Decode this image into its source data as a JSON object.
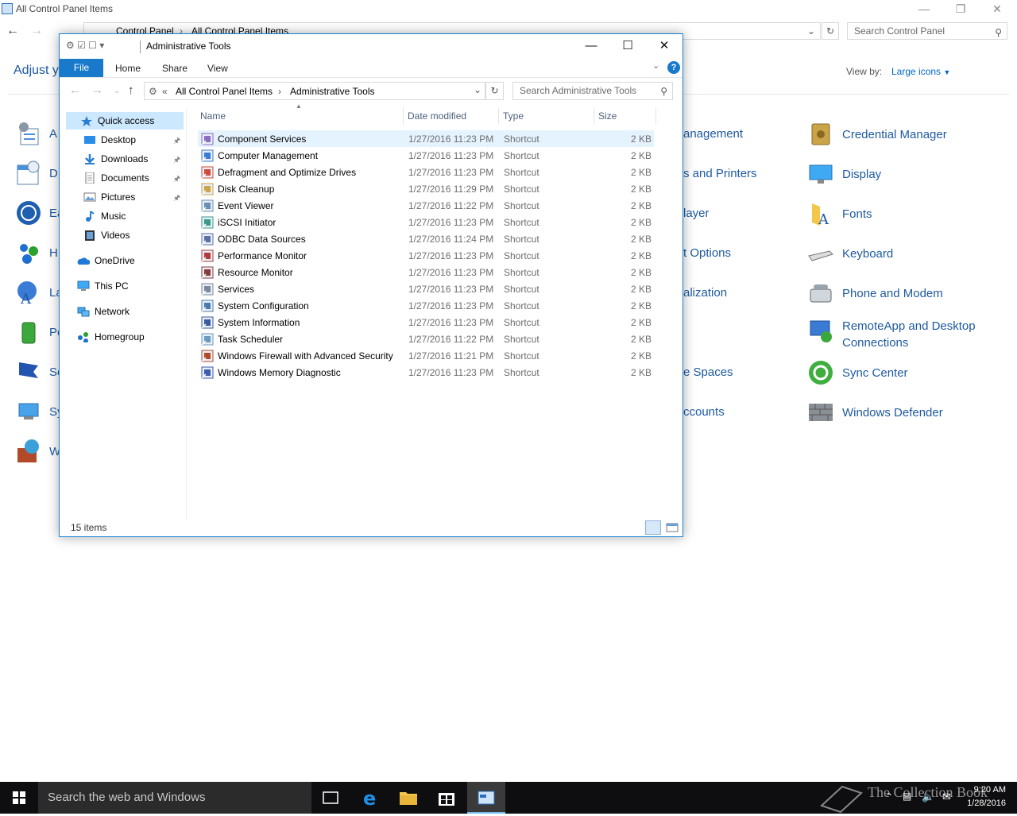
{
  "cp": {
    "title": "All Control Panel Items",
    "breadcrumb": [
      "Control Panel",
      "All Control Panel Items"
    ],
    "search_placeholder": "Search Control Panel",
    "adjust": "Adjust y",
    "view_by_label": "View by:",
    "view_by_value": "Large icons",
    "left_partial": [
      "A",
      "D",
      "Ea",
      "H",
      "La",
      "Po",
      "Se",
      "Sy",
      "W"
    ],
    "mid_partial": [
      "anagement",
      "s and Printers",
      "layer",
      "t Options",
      "alization",
      "",
      "e Spaces",
      "ccounts"
    ],
    "right_items": [
      "Credential Manager",
      "Display",
      "Fonts",
      "Keyboard",
      "Phone and Modem",
      "RemoteApp and Desktop Connections",
      "Sync Center",
      "Windows Defender"
    ]
  },
  "explorer": {
    "title": "Administrative Tools",
    "tabs": {
      "file": "File",
      "home": "Home",
      "share": "Share",
      "view": "View"
    },
    "address": [
      "All Control Panel Items",
      "Administrative Tools"
    ],
    "address_prefix": "«",
    "search_placeholder": "Search Administrative Tools",
    "nav": {
      "quick_access": "Quick access",
      "desktop": "Desktop",
      "downloads": "Downloads",
      "documents": "Documents",
      "pictures": "Pictures",
      "music": "Music",
      "videos": "Videos",
      "onedrive": "OneDrive",
      "thispc": "This PC",
      "network": "Network",
      "homegroup": "Homegroup"
    },
    "columns": {
      "name": "Name",
      "date": "Date modified",
      "type": "Type",
      "size": "Size"
    },
    "files": [
      {
        "name": "Component Services",
        "date": "1/27/2016 11:23 PM",
        "type": "Shortcut",
        "size": "2 KB"
      },
      {
        "name": "Computer Management",
        "date": "1/27/2016 11:23 PM",
        "type": "Shortcut",
        "size": "2 KB"
      },
      {
        "name": "Defragment and Optimize Drives",
        "date": "1/27/2016 11:23 PM",
        "type": "Shortcut",
        "size": "2 KB"
      },
      {
        "name": "Disk Cleanup",
        "date": "1/27/2016 11:29 PM",
        "type": "Shortcut",
        "size": "2 KB"
      },
      {
        "name": "Event Viewer",
        "date": "1/27/2016 11:22 PM",
        "type": "Shortcut",
        "size": "2 KB"
      },
      {
        "name": "iSCSI Initiator",
        "date": "1/27/2016 11:23 PM",
        "type": "Shortcut",
        "size": "2 KB"
      },
      {
        "name": "ODBC Data Sources",
        "date": "1/27/2016 11:24 PM",
        "type": "Shortcut",
        "size": "2 KB"
      },
      {
        "name": "Performance Monitor",
        "date": "1/27/2016 11:23 PM",
        "type": "Shortcut",
        "size": "2 KB"
      },
      {
        "name": "Resource Monitor",
        "date": "1/27/2016 11:23 PM",
        "type": "Shortcut",
        "size": "2 KB"
      },
      {
        "name": "Services",
        "date": "1/27/2016 11:23 PM",
        "type": "Shortcut",
        "size": "2 KB"
      },
      {
        "name": "System Configuration",
        "date": "1/27/2016 11:23 PM",
        "type": "Shortcut",
        "size": "2 KB"
      },
      {
        "name": "System Information",
        "date": "1/27/2016 11:23 PM",
        "type": "Shortcut",
        "size": "2 KB"
      },
      {
        "name": "Task Scheduler",
        "date": "1/27/2016 11:22 PM",
        "type": "Shortcut",
        "size": "2 KB"
      },
      {
        "name": "Windows Firewall with Advanced Security",
        "date": "1/27/2016 11:21 PM",
        "type": "Shortcut",
        "size": "2 KB"
      },
      {
        "name": "Windows Memory Diagnostic",
        "date": "1/27/2016 11:23 PM",
        "type": "Shortcut",
        "size": "2 KB"
      }
    ],
    "status": "15 items"
  },
  "taskbar": {
    "search_placeholder": "Search the web and Windows",
    "time": "9:20 AM",
    "date": "1/28/2016",
    "watermark": "The Collection Book"
  },
  "colors": {
    "accent": "#1979ca",
    "link": "#1e5aa0",
    "selection": "#e5f3ff"
  }
}
